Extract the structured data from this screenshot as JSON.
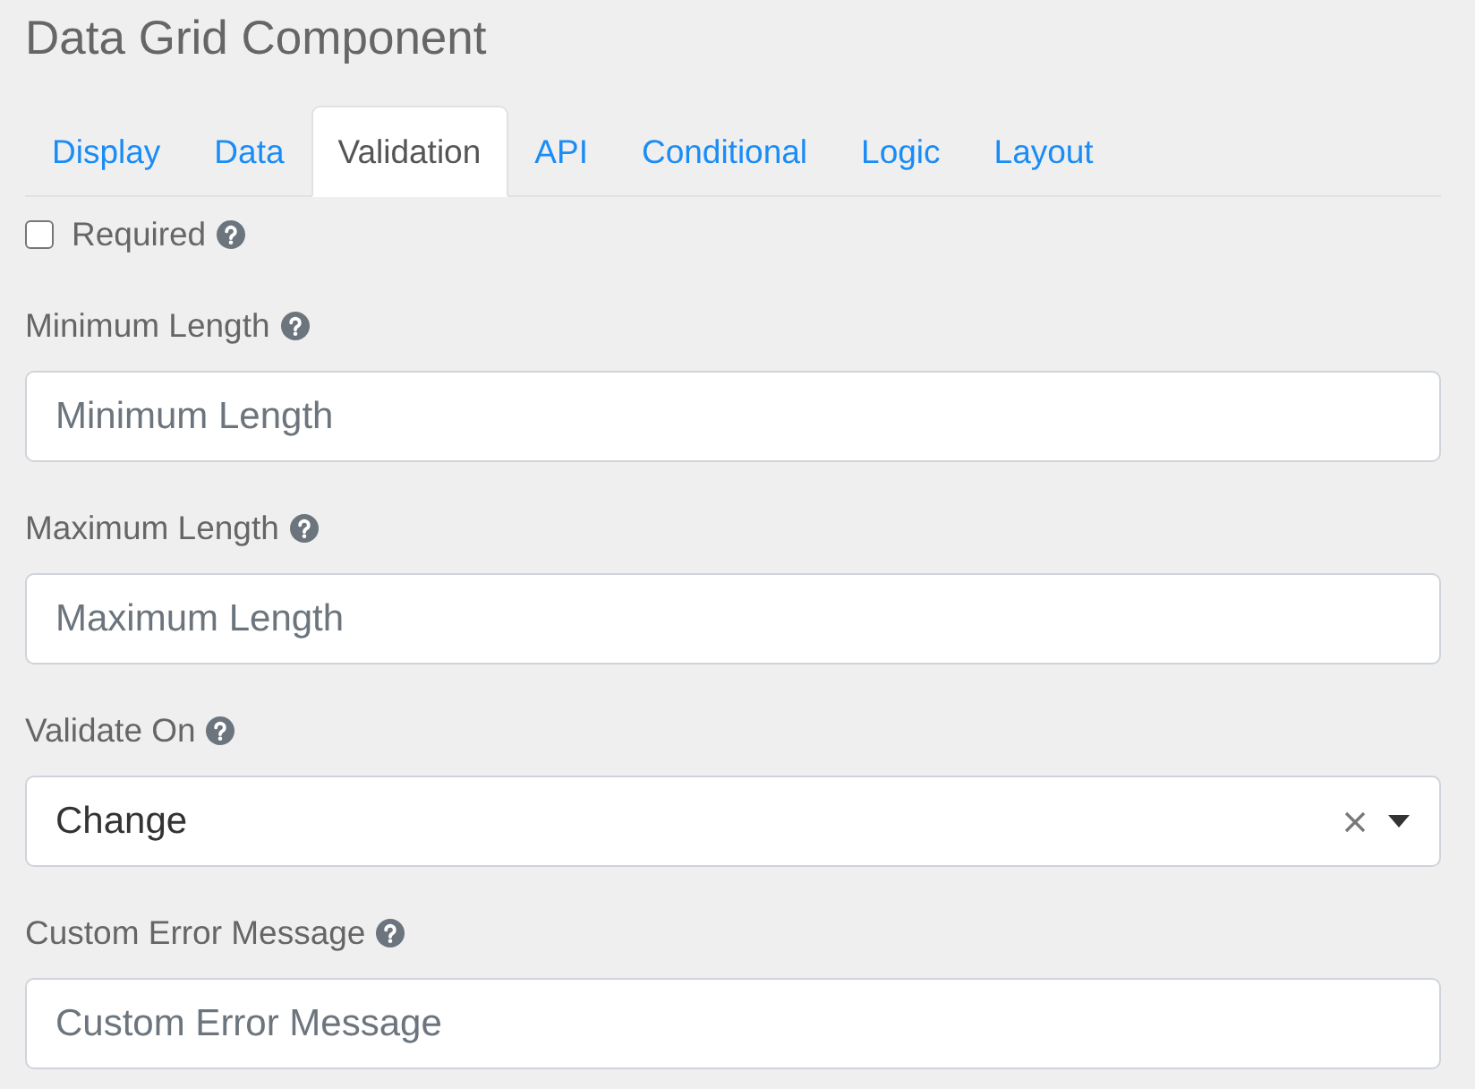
{
  "title": "Data Grid Component",
  "tabs": [
    {
      "label": "Display",
      "selected": false
    },
    {
      "label": "Data",
      "selected": false
    },
    {
      "label": "Validation",
      "selected": true
    },
    {
      "label": "API",
      "selected": false
    },
    {
      "label": "Conditional",
      "selected": false
    },
    {
      "label": "Logic",
      "selected": false
    },
    {
      "label": "Layout",
      "selected": false
    }
  ],
  "fields": [
    {
      "kind": "checkbox",
      "label": "Required",
      "checked": false,
      "help": true
    },
    {
      "kind": "text",
      "label": "Minimum Length",
      "placeholder": "Minimum Length",
      "help": true
    },
    {
      "kind": "text",
      "label": "Maximum Length",
      "placeholder": "Maximum Length",
      "help": true
    },
    {
      "kind": "select",
      "label": "Validate On",
      "value": "Change",
      "help": true
    },
    {
      "kind": "text",
      "label": "Custom Error Message",
      "placeholder": "Custom Error Message",
      "help": true
    }
  ]
}
